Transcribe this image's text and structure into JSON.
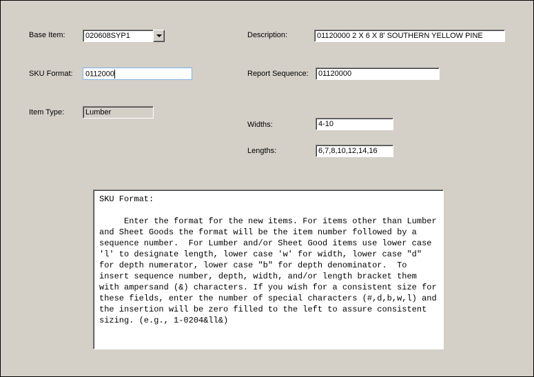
{
  "labels": {
    "baseItem": "Base Item:",
    "description": "Description:",
    "skuFormat": "SKU Format:",
    "reportSequence": "Report Sequence:",
    "itemType": "Item Type:",
    "widths": "Widths:",
    "lengths": "Lengths:"
  },
  "fields": {
    "baseItem": "020608SYP1",
    "description": "01120000 2 X 6 X 8' SOUTHERN YELLOW PINE",
    "skuFormat": "0112000",
    "reportSequence": "01120000",
    "itemType": "Lumber",
    "widths": "4-10",
    "lengths": "6,7,8,10,12,14,16"
  },
  "helpTitle": "SKU Format:",
  "helpBody": "     Enter the format for the new items. For items other than Lumber and Sheet Goods the format will be the item number followed by a sequence number.  For Lumber and/or Sheet Good items use lower case 'l' to designate length, lower case 'w' for width, lower case \"d\" for depth numerator, lower case \"b\" for depth denominator.  To insert sequence number, depth, width, and/or length bracket them with ampersand (&) characters. If you wish for a consistent size for these fields, enter the number of special characters (#,d,b,w,l) and the insertion will be zero filled to the left to assure consistent sizing. (e.g., 1-0204&ll&)"
}
